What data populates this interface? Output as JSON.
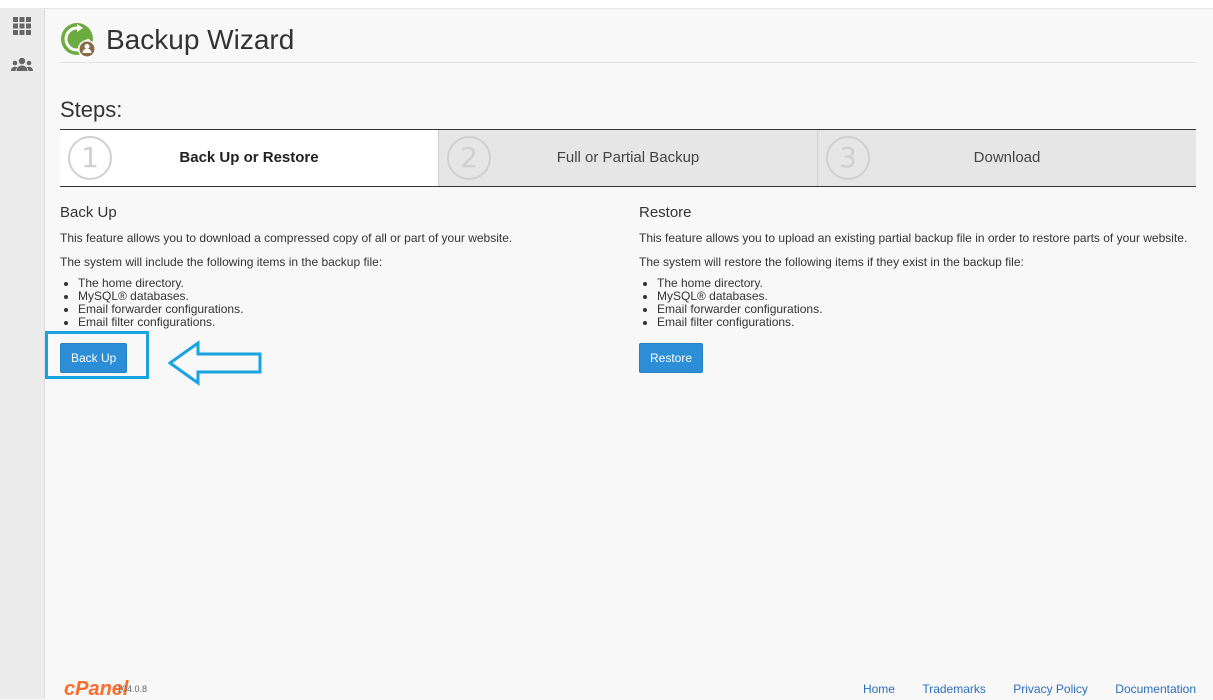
{
  "page": {
    "title": "Backup Wizard"
  },
  "steps": {
    "heading": "Steps:",
    "items": [
      {
        "number": "1",
        "label": "Back Up or Restore"
      },
      {
        "number": "2",
        "label": "Full or Partial Backup"
      },
      {
        "number": "3",
        "label": "Download"
      }
    ]
  },
  "backup": {
    "heading": "Back Up",
    "description": "This feature allows you to download a compressed copy of all or part of your website.",
    "intro": "The system will include the following items in the backup file:",
    "items": [
      "The home directory.",
      "MySQL® databases.",
      "Email forwarder configurations.",
      "Email filter configurations."
    ],
    "button": "Back Up"
  },
  "restore": {
    "heading": "Restore",
    "description": "This feature allows you to upload an existing partial backup file in order to restore parts of your website.",
    "intro": "The system will restore the following items if they exist in the backup file:",
    "items": [
      "The home directory.",
      "MySQL® databases.",
      "Email forwarder configurations.",
      "Email filter configurations."
    ],
    "button": "Restore"
  },
  "footer": {
    "brand": "cPanel",
    "version": "104.0.8",
    "links": [
      "Home",
      "Trademarks",
      "Privacy Policy",
      "Documentation"
    ]
  },
  "icons": {
    "sidebar": [
      "grid-icon",
      "users-icon"
    ],
    "page": "backup-wizard-icon"
  },
  "colors": {
    "primary_button": "#2c8ed6",
    "highlight": "#19a3e0",
    "cpanel_orange": "#ff6c2c",
    "link": "#2a6ebb"
  }
}
